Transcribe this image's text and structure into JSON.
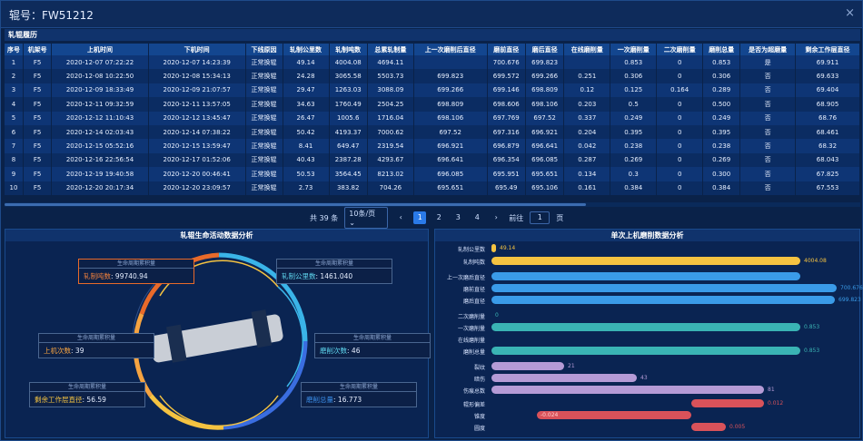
{
  "window": {
    "title": "辊号：FW51212",
    "close": "×"
  },
  "section_title": "轧辊履历",
  "table": {
    "headers": [
      "序号",
      "机架号",
      "上机时间",
      "下机时间",
      "下线原因",
      "轧制公里数",
      "轧制吨数",
      "总累轧制量",
      "上一次磨削后直径",
      "磨前直径",
      "磨后直径",
      "在线磨削量",
      "一次磨削量",
      "二次磨削量",
      "磨削总量",
      "是否为超磨量",
      "剩余工作层直径"
    ],
    "rows": [
      [
        "1",
        "F5",
        "2020-12-07 07:22:22",
        "2020-12-07 14:23:39",
        "正常换辊",
        "49.14",
        "4004.08",
        "4694.11",
        "",
        "700.676",
        "699.823",
        "",
        "0.853",
        "0",
        "0.853",
        "是",
        "69.911"
      ],
      [
        "2",
        "F5",
        "2020-12-08 10:22:50",
        "2020-12-08 15:34:13",
        "正常换辊",
        "24.28",
        "3065.58",
        "5503.73",
        "699.823",
        "699.572",
        "699.266",
        "0.251",
        "0.306",
        "0",
        "0.306",
        "否",
        "69.633"
      ],
      [
        "3",
        "F5",
        "2020-12-09 18:33:49",
        "2020-12-09 21:07:57",
        "正常换辊",
        "29.47",
        "1263.03",
        "3088.09",
        "699.266",
        "699.146",
        "698.809",
        "0.12",
        "0.125",
        "0.164",
        "0.289",
        "否",
        "69.404"
      ],
      [
        "4",
        "F5",
        "2020-12-11 09:32:59",
        "2020-12-11 13:57:05",
        "正常换辊",
        "34.63",
        "1760.49",
        "2504.25",
        "698.809",
        "698.606",
        "698.106",
        "0.203",
        "0.5",
        "0",
        "0.500",
        "否",
        "68.905"
      ],
      [
        "5",
        "F5",
        "2020-12-12 11:10:43",
        "2020-12-12 13:45:47",
        "正常换辊",
        "26.47",
        "1005.6",
        "1716.04",
        "698.106",
        "697.769",
        "697.52",
        "0.337",
        "0.249",
        "0",
        "0.249",
        "否",
        "68.76"
      ],
      [
        "6",
        "F5",
        "2020-12-14 02:03:43",
        "2020-12-14 07:38:22",
        "正常换辊",
        "50.42",
        "4193.37",
        "7000.62",
        "697.52",
        "697.316",
        "696.921",
        "0.204",
        "0.395",
        "0",
        "0.395",
        "否",
        "68.461"
      ],
      [
        "7",
        "F5",
        "2020-12-15 05:52:16",
        "2020-12-15 13:59:47",
        "正常换辊",
        "8.41",
        "649.47",
        "2319.54",
        "696.921",
        "696.879",
        "696.641",
        "0.042",
        "0.238",
        "0",
        "0.238",
        "否",
        "68.32"
      ],
      [
        "8",
        "F5",
        "2020-12-16 22:56:54",
        "2020-12-17 01:52:06",
        "正常换辊",
        "40.43",
        "2387.28",
        "4293.67",
        "696.641",
        "696.354",
        "696.085",
        "0.287",
        "0.269",
        "0",
        "0.269",
        "否",
        "68.043"
      ],
      [
        "9",
        "F5",
        "2020-12-19 19:40:58",
        "2020-12-20 00:46:41",
        "正常换辊",
        "50.53",
        "3564.45",
        "8213.02",
        "696.085",
        "695.951",
        "695.651",
        "0.134",
        "0.3",
        "0",
        "0.300",
        "否",
        "67.825"
      ],
      [
        "10",
        "F5",
        "2020-12-20 20:17:34",
        "2020-12-20 23:09:57",
        "正常换辊",
        "2.73",
        "383.82",
        "704.26",
        "695.651",
        "695.49",
        "695.106",
        "0.161",
        "0.384",
        "0",
        "0.384",
        "否",
        "67.553"
      ]
    ]
  },
  "pager": {
    "total": "共 39 条",
    "page_size": "10条/页",
    "prev": "‹",
    "next": "›",
    "pages": [
      "1",
      "2",
      "3",
      "4"
    ],
    "goto_label": "前往",
    "goto_value": "1",
    "goto_unit": "页"
  },
  "left_panel": {
    "title": "轧辊生命活动数据分析",
    "cards": [
      {
        "top": "生命周期累积量",
        "label": "轧制吨数",
        "value": "99740.94"
      },
      {
        "top": "生命周期累积量",
        "label": "轧制公里数",
        "value": "1461.040"
      },
      {
        "top": "生命周期累积量",
        "label": "上机次数",
        "value": "39"
      },
      {
        "top": "生命周期累积量",
        "label": "磨削次数",
        "value": "46"
      },
      {
        "top": "生命周期累积量",
        "label": "剩余工作层直径",
        "value": "56.59"
      },
      {
        "top": "生命周期累积量",
        "label": "磨削总量",
        "value": "16.773"
      }
    ]
  },
  "right_panel": {
    "title": "单次上机磨削数据分析",
    "bars": [
      {
        "label": "轧制公里数",
        "value": 49.14,
        "text": "49.14",
        "color": "#f5c341"
      },
      {
        "label": "轧制吨数",
        "value": 4004.08,
        "text": "4004.08",
        "color": "#f5c341"
      },
      {
        "label": "上一次磨后直径",
        "value": 0,
        "text": "",
        "color": "#3a9be8"
      },
      {
        "label": "磨前直径",
        "value": 700.676,
        "text": "700.676",
        "color": "#3a9be8"
      },
      {
        "label": "磨后直径",
        "value": 699.823,
        "text": "699.823",
        "color": "#3a9be8"
      },
      {
        "label": "二次磨削量",
        "value": 0,
        "text": "0",
        "color": "#3ab4b4"
      },
      {
        "label": "一次磨削量",
        "value": 0.853,
        "text": "0.853",
        "color": "#3ab4b4"
      },
      {
        "label": "在线磨削量",
        "value": 0,
        "text": "",
        "color": "#3ab4b4"
      },
      {
        "label": "磨削总量",
        "value": 0.853,
        "text": "0.853",
        "color": "#3ab4b4"
      },
      {
        "label": "裂纹",
        "value": 21,
        "text": "21",
        "color": "#b59bd6"
      },
      {
        "label": "暗伤",
        "value": 43,
        "text": "43",
        "color": "#b59bd6"
      },
      {
        "label": "伤痕总数",
        "value": 81,
        "text": "81",
        "color": "#b59bd6"
      },
      {
        "label": "辊形偏差",
        "value": 0.012,
        "text": "0.012",
        "color": "#d9525a"
      },
      {
        "label": "锥度",
        "value": -0.024,
        "text": "-0.024",
        "color": "#d9525a"
      },
      {
        "label": "圆度",
        "value": 0.005,
        "text": "0.005",
        "color": "#d9525a"
      }
    ]
  }
}
